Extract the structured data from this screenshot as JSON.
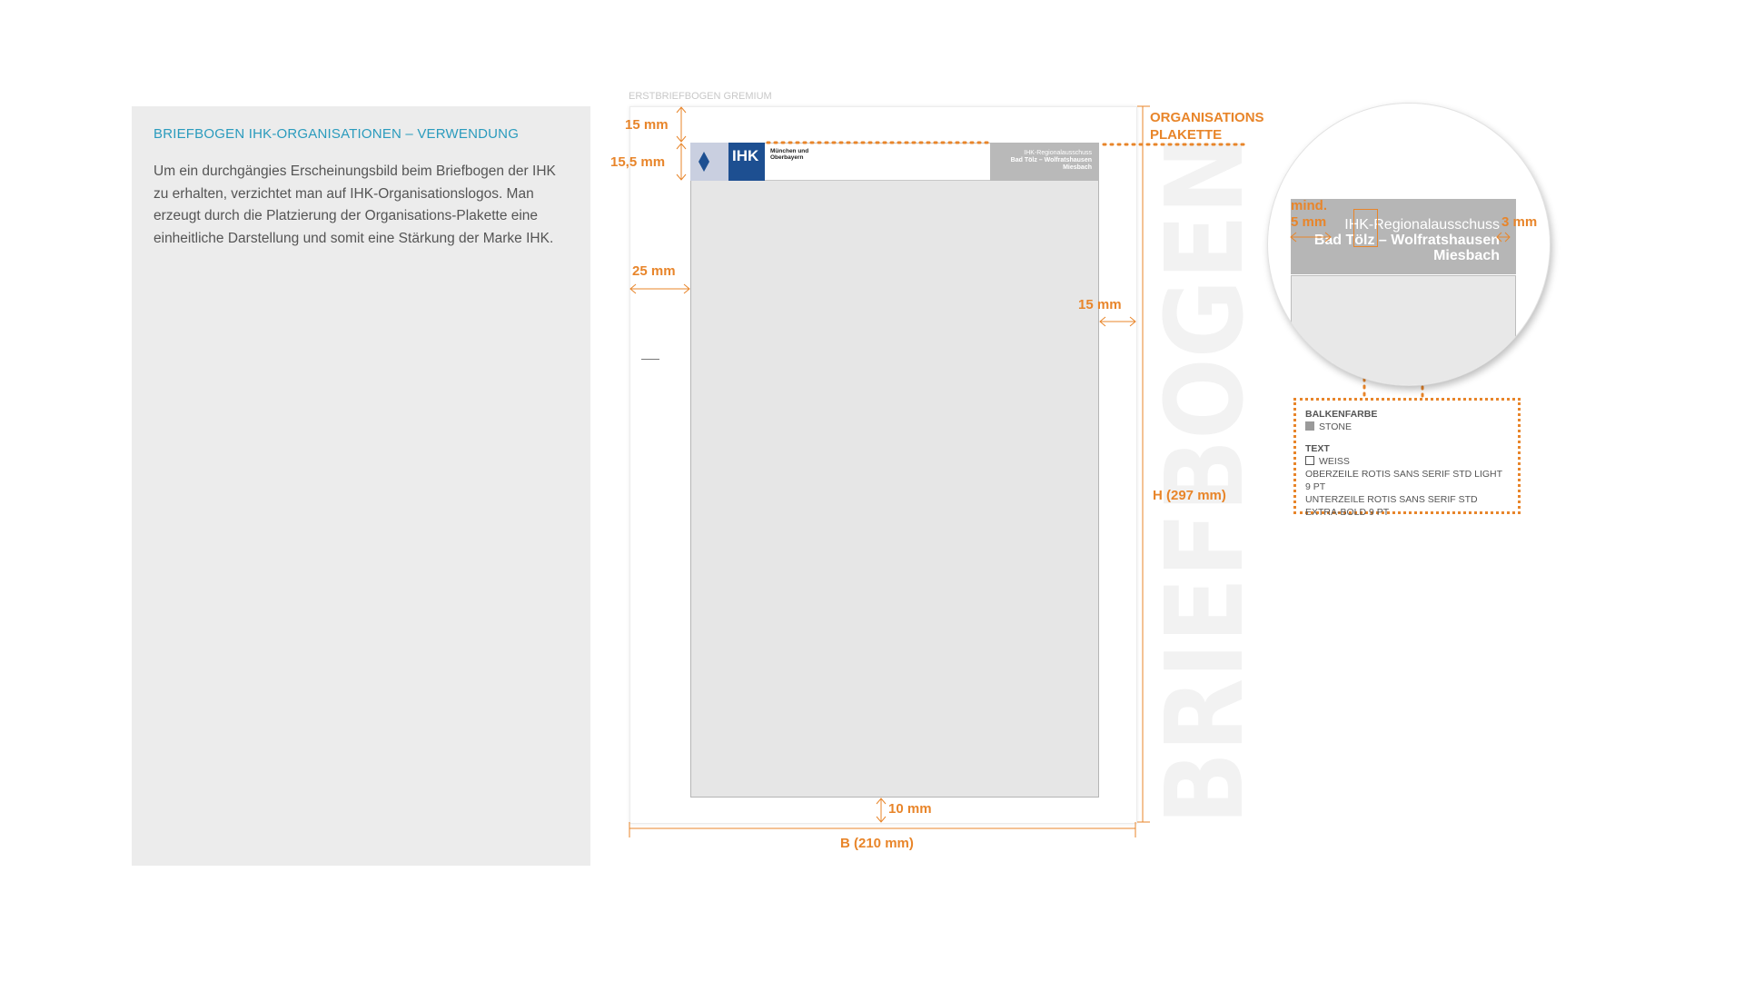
{
  "panel": {
    "title": "BRIEFBOGEN IHK-ORGANISATIONEN – VERWENDUNG",
    "text": "Um ein durchgängies Erscheinungsbild beim Briefbogen der IHK zu erhalten, verzichtet man auf IHK-Organisationslogos. Man erzeugt durch die Platzierung der Organisations-Plakette eine einheitliche Darstellung und somit eine Stärkung der Marke IHK."
  },
  "sheet": {
    "label": "ERSTBRIEFBOGEN GREMIUM",
    "logo_text": "IHK",
    "logo_sub1": "München und",
    "logo_sub2": "Oberbayern",
    "plakette_line1": "IHK-Regionalausschuss",
    "plakette_line2": "Bad Tölz – Wolfratshausen",
    "plakette_line3": "Miesbach",
    "big_word": "BRIEFBOGEN"
  },
  "dimensions": {
    "top_margin": "15 mm",
    "header_height": "15,5 mm",
    "left_margin": "25 mm",
    "right_margin": "15 mm",
    "bottom_margin": "10 mm",
    "width": "B (210 mm)",
    "height": "H (297 mm)",
    "plakette_label_1": "ORGANISATIONS",
    "plakette_label_2": "PLAKETTE"
  },
  "lens": {
    "min_label": "mind.",
    "left_dim": "5 mm",
    "right_dim": "3 mm",
    "line1": "IHK-Regionalausschuss",
    "line2": "Bad Tölz – Wolfratshausen",
    "line3": "Miesbach"
  },
  "spec": {
    "bar_heading": "BALKENFARBE",
    "bar_color_name": "STONE",
    "text_heading": "TEXT",
    "text_color_name": "WEISS",
    "line_upper": "OBERZEILE ROTIS SANS SERIF STD LIGHT 9 PT",
    "line_lower": "UNTERZEILE ROTIS SANS SERIF STD EXTRA-BOLD 9 PT"
  },
  "colors": {
    "accent": "#e8852a",
    "title_blue": "#2a9bbd",
    "stone": "#b9b9b9",
    "ihk_blue": "#1d4f91"
  }
}
